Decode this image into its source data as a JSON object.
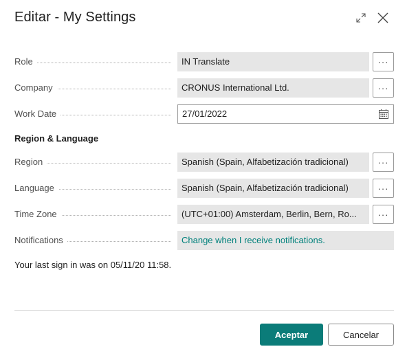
{
  "dialog": {
    "title": "Editar - My Settings"
  },
  "fields": {
    "role": {
      "label": "Role",
      "value": "IN Translate"
    },
    "company": {
      "label": "Company",
      "value": "CRONUS International Ltd."
    },
    "work_date": {
      "label": "Work Date",
      "value": "27/01/2022"
    },
    "region": {
      "label": "Region",
      "value": "Spanish (Spain, Alfabetización tradicional)"
    },
    "language": {
      "label": "Language",
      "value": "Spanish (Spain, Alfabetización tradicional)"
    },
    "time_zone": {
      "label": "Time Zone",
      "value": "(UTC+01:00) Amsterdam, Berlin, Bern, Ro..."
    },
    "notifications": {
      "label": "Notifications",
      "value": "Change when I receive notifications."
    }
  },
  "section": {
    "region_language": "Region & Language"
  },
  "ellipsis_label": "···",
  "last_sign_in": "Your last sign in was on 05/11/20 11:58.",
  "buttons": {
    "ok": "Aceptar",
    "cancel": "Cancelar"
  },
  "colors": {
    "accent": "#0b7c79",
    "link": "#00807b",
    "field_bg": "#e6e6e6"
  },
  "icons": {
    "expand": "expand-icon",
    "close": "close-icon",
    "calendar": "calendar-icon"
  }
}
